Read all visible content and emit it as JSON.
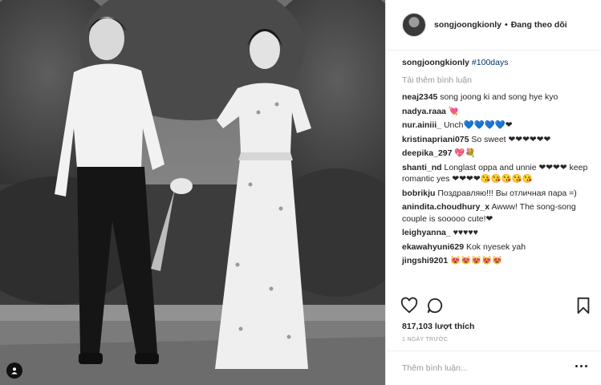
{
  "post": {
    "author": "songjoongkionly",
    "follow_separator": "•",
    "follow_status": "Đang theo dõi",
    "caption_user": "songjoongkionly",
    "caption_text": "#100days",
    "load_more": "Tải thêm bình luận",
    "comments": [
      {
        "user": "neaj2345",
        "text": "song joong ki and song hye kyo"
      },
      {
        "user": "nadya.raaa",
        "text": "💘"
      },
      {
        "user": "nur.ainiii_",
        "text": "Unch💙💙💙💙❤"
      },
      {
        "user": "kristinapriani075",
        "text": "So sweet ❤❤❤❤❤❤"
      },
      {
        "user": "deepika_297",
        "text": "💖💐"
      },
      {
        "user": "shanti_nd",
        "text": "Longlast oppa and unnie ❤❤❤❤ keep romantic yes ❤❤❤❤😘😘😘😘😘"
      },
      {
        "user": "bobrikju",
        "text": "Поздравляю!!! Вы отличная пара =)"
      },
      {
        "user": "anindita.choudhury_x",
        "text": "Awww! The song-song couple is sooooo cute!❤"
      },
      {
        "user": "leighyanna_",
        "text": "♥♥♥♥♥"
      },
      {
        "user": "ekawahyuni629",
        "text": "Kok nyesek yah"
      },
      {
        "user": "jingshi9201",
        "text": "😻😻😻😻😻"
      }
    ],
    "likes": "817,103 lượt thích",
    "time": "1 NGÀY TRƯỚC",
    "add_comment_placeholder": "Thêm bình luận..."
  },
  "icons": {
    "like": "heart-outline-icon",
    "comment": "speech-bubble-icon",
    "save": "bookmark-icon",
    "more": "more-dots-icon",
    "tag": "user-tag-icon"
  },
  "colors": {
    "text": "#262626",
    "muted": "#999999",
    "hashtag": "#003569",
    "border": "#efefef"
  }
}
